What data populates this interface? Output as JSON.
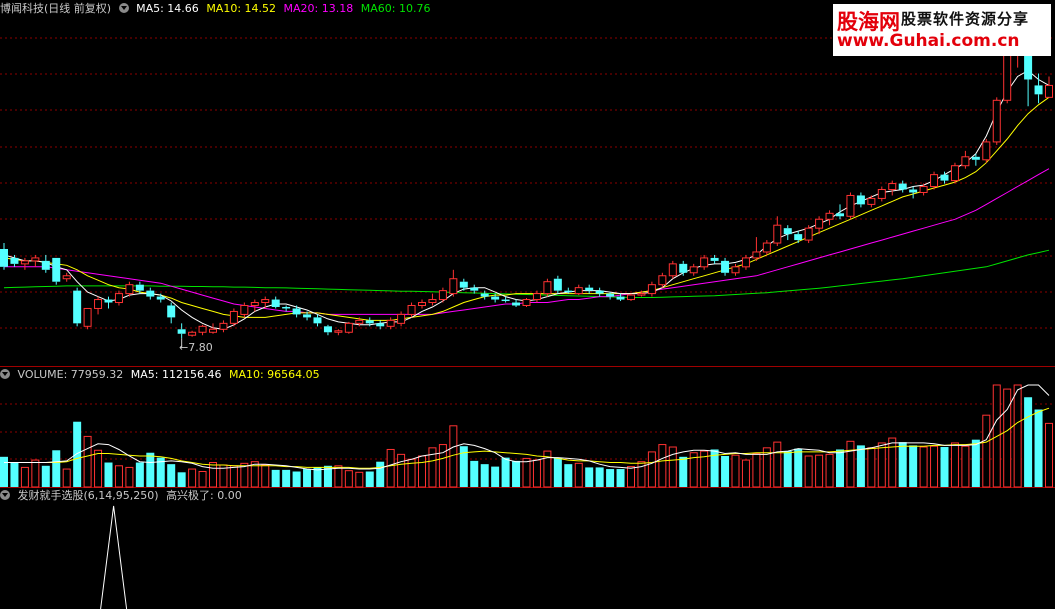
{
  "main_header": {
    "title": "博闻科技(日线 前复权)",
    "ma5": "MA5: 14.66",
    "ma10": "MA10: 14.52",
    "ma20": "MA20: 13.18",
    "ma60": "MA60: 10.76"
  },
  "volume_header": {
    "title": "VOLUME: 77959.32",
    "ma5": "MA5: 112156.46",
    "ma10": "MA10: 96564.05"
  },
  "indicator_header": {
    "title": "发财就手选股(6,14,95,250)",
    "value": "高兴极了: 0.00"
  },
  "watermark": {
    "brand": "股海网",
    "slogan": "股票软件资源分享",
    "url": "www.Guhai.com.cn"
  },
  "low_marker": "7.80",
  "colors": {
    "up": "#ff3232",
    "down": "#54ffff",
    "ma5": "#ffffff",
    "ma10": "#ffff00",
    "ma20": "#ff00ff",
    "ma60": "#00e400",
    "grid": "#8b0000",
    "divider": "#a00000",
    "header_text": "#c8c8c8"
  },
  "chart_data": {
    "type": "candlestick",
    "price_range": [
      7.0,
      18.5
    ],
    "candles": [
      {
        "o": 10.8,
        "c": 10.2,
        "h": 11.0,
        "l": 10.1
      },
      {
        "o": 10.5,
        "c": 10.3,
        "h": 10.6,
        "l": 10.2
      },
      {
        "o": 10.3,
        "c": 10.4,
        "h": 10.5,
        "l": 10.1
      },
      {
        "o": 10.4,
        "c": 10.5,
        "h": 10.6,
        "l": 10.2
      },
      {
        "o": 10.4,
        "c": 10.1,
        "h": 10.6,
        "l": 10.0
      },
      {
        "o": 10.5,
        "c": 9.7,
        "h": 10.5,
        "l": 9.6
      },
      {
        "o": 9.8,
        "c": 9.9,
        "h": 10.0,
        "l": 9.7
      },
      {
        "o": 9.4,
        "c": 8.3,
        "h": 9.5,
        "l": 8.2
      },
      {
        "o": 8.2,
        "c": 8.8,
        "h": 8.8,
        "l": 8.1
      },
      {
        "o": 8.8,
        "c": 9.1,
        "h": 9.2,
        "l": 8.6
      },
      {
        "o": 9.1,
        "c": 9.0,
        "h": 9.2,
        "l": 8.8
      },
      {
        "o": 9.0,
        "c": 9.3,
        "h": 9.4,
        "l": 8.9
      },
      {
        "o": 9.3,
        "c": 9.6,
        "h": 9.7,
        "l": 9.2
      },
      {
        "o": 9.6,
        "c": 9.4,
        "h": 9.7,
        "l": 9.3
      },
      {
        "o": 9.4,
        "c": 9.2,
        "h": 9.5,
        "l": 9.1
      },
      {
        "o": 9.2,
        "c": 9.1,
        "h": 9.3,
        "l": 9.0
      },
      {
        "o": 8.9,
        "c": 8.5,
        "h": 9.0,
        "l": 8.3
      },
      {
        "o": 8.1,
        "c": 7.95,
        "h": 8.3,
        "l": 7.8
      },
      {
        "o": 7.9,
        "c": 8.0,
        "h": 8.05,
        "l": 7.85
      },
      {
        "o": 8.0,
        "c": 8.2,
        "h": 8.25,
        "l": 7.9
      },
      {
        "o": 8.0,
        "c": 8.1,
        "h": 8.3,
        "l": 7.95
      },
      {
        "o": 8.1,
        "c": 8.3,
        "h": 8.4,
        "l": 8.0
      },
      {
        "o": 8.3,
        "c": 8.7,
        "h": 8.8,
        "l": 8.2
      },
      {
        "o": 8.6,
        "c": 8.9,
        "h": 9.0,
        "l": 8.5
      },
      {
        "o": 8.9,
        "c": 9.0,
        "h": 9.1,
        "l": 8.7
      },
      {
        "o": 9.0,
        "c": 9.1,
        "h": 9.2,
        "l": 8.8
      },
      {
        "o": 9.1,
        "c": 8.85,
        "h": 9.2,
        "l": 8.8
      },
      {
        "o": 8.85,
        "c": 8.8,
        "h": 8.9,
        "l": 8.7
      },
      {
        "o": 8.8,
        "c": 8.6,
        "h": 8.9,
        "l": 8.5
      },
      {
        "o": 8.6,
        "c": 8.5,
        "h": 8.7,
        "l": 8.4
      },
      {
        "o": 8.5,
        "c": 8.3,
        "h": 8.6,
        "l": 8.2
      },
      {
        "o": 8.2,
        "c": 8.0,
        "h": 8.25,
        "l": 7.9
      },
      {
        "o": 8.0,
        "c": 8.05,
        "h": 8.1,
        "l": 7.9
      },
      {
        "o": 8.0,
        "c": 8.3,
        "h": 8.35,
        "l": 7.95
      },
      {
        "o": 8.3,
        "c": 8.4,
        "h": 8.5,
        "l": 8.2
      },
      {
        "o": 8.4,
        "c": 8.3,
        "h": 8.5,
        "l": 8.2
      },
      {
        "o": 8.3,
        "c": 8.2,
        "h": 8.4,
        "l": 8.1
      },
      {
        "o": 8.2,
        "c": 8.4,
        "h": 8.5,
        "l": 8.1
      },
      {
        "o": 8.3,
        "c": 8.6,
        "h": 8.7,
        "l": 8.2
      },
      {
        "o": 8.6,
        "c": 8.9,
        "h": 9.0,
        "l": 8.5
      },
      {
        "o": 8.9,
        "c": 9.0,
        "h": 9.1,
        "l": 8.8
      },
      {
        "o": 9.0,
        "c": 9.1,
        "h": 9.3,
        "l": 8.9
      },
      {
        "o": 9.1,
        "c": 9.4,
        "h": 9.5,
        "l": 9.0
      },
      {
        "o": 9.3,
        "c": 9.8,
        "h": 10.1,
        "l": 9.2
      },
      {
        "o": 9.7,
        "c": 9.5,
        "h": 9.8,
        "l": 9.4
      },
      {
        "o": 9.5,
        "c": 9.4,
        "h": 9.6,
        "l": 9.3
      },
      {
        "o": 9.3,
        "c": 9.2,
        "h": 9.4,
        "l": 9.1
      },
      {
        "o": 9.2,
        "c": 9.1,
        "h": 9.3,
        "l": 9.0
      },
      {
        "o": 9.1,
        "c": 9.05,
        "h": 9.2,
        "l": 9.0
      },
      {
        "o": 9.0,
        "c": 8.9,
        "h": 9.1,
        "l": 8.85
      },
      {
        "o": 8.9,
        "c": 9.1,
        "h": 9.15,
        "l": 8.85
      },
      {
        "o": 9.1,
        "c": 9.3,
        "h": 9.4,
        "l": 9.0
      },
      {
        "o": 9.3,
        "c": 9.7,
        "h": 9.8,
        "l": 9.2
      },
      {
        "o": 9.8,
        "c": 9.4,
        "h": 9.9,
        "l": 9.3
      },
      {
        "o": 9.4,
        "c": 9.35,
        "h": 9.5,
        "l": 9.3
      },
      {
        "o": 9.3,
        "c": 9.5,
        "h": 9.6,
        "l": 9.25
      },
      {
        "o": 9.5,
        "c": 9.4,
        "h": 9.6,
        "l": 9.3
      },
      {
        "o": 9.4,
        "c": 9.3,
        "h": 9.5,
        "l": 9.2
      },
      {
        "o": 9.3,
        "c": 9.2,
        "h": 9.35,
        "l": 9.1
      },
      {
        "o": 9.2,
        "c": 9.1,
        "h": 9.3,
        "l": 9.05
      },
      {
        "o": 9.1,
        "c": 9.25,
        "h": 9.3,
        "l": 9.05
      },
      {
        "o": 9.25,
        "c": 9.3,
        "h": 9.4,
        "l": 9.2
      },
      {
        "o": 9.3,
        "c": 9.6,
        "h": 9.7,
        "l": 9.2
      },
      {
        "o": 9.6,
        "c": 9.9,
        "h": 10.0,
        "l": 9.5
      },
      {
        "o": 9.9,
        "c": 10.3,
        "h": 10.4,
        "l": 9.8
      },
      {
        "o": 10.3,
        "c": 10.0,
        "h": 10.4,
        "l": 9.9
      },
      {
        "o": 10.0,
        "c": 10.2,
        "h": 10.3,
        "l": 9.9
      },
      {
        "o": 10.2,
        "c": 10.5,
        "h": 10.6,
        "l": 10.1
      },
      {
        "o": 10.5,
        "c": 10.4,
        "h": 10.6,
        "l": 10.3
      },
      {
        "o": 10.4,
        "c": 10.0,
        "h": 10.5,
        "l": 9.9
      },
      {
        "o": 10.0,
        "c": 10.2,
        "h": 10.3,
        "l": 9.9
      },
      {
        "o": 10.2,
        "c": 10.5,
        "h": 10.6,
        "l": 10.1
      },
      {
        "o": 10.5,
        "c": 10.7,
        "h": 11.2,
        "l": 10.4
      },
      {
        "o": 10.7,
        "c": 11.0,
        "h": 11.1,
        "l": 10.6
      },
      {
        "o": 11.0,
        "c": 11.6,
        "h": 11.9,
        "l": 10.9
      },
      {
        "o": 11.5,
        "c": 11.3,
        "h": 11.6,
        "l": 11.1
      },
      {
        "o": 11.3,
        "c": 11.1,
        "h": 11.4,
        "l": 11.0
      },
      {
        "o": 11.1,
        "c": 11.5,
        "h": 11.6,
        "l": 11.0
      },
      {
        "o": 11.5,
        "c": 11.8,
        "h": 11.9,
        "l": 11.3
      },
      {
        "o": 11.8,
        "c": 12.0,
        "h": 12.1,
        "l": 11.6
      },
      {
        "o": 12.0,
        "c": 11.9,
        "h": 12.3,
        "l": 11.8
      },
      {
        "o": 11.9,
        "c": 12.6,
        "h": 12.7,
        "l": 11.8
      },
      {
        "o": 12.6,
        "c": 12.3,
        "h": 12.7,
        "l": 12.2
      },
      {
        "o": 12.3,
        "c": 12.5,
        "h": 12.6,
        "l": 12.2
      },
      {
        "o": 12.5,
        "c": 12.8,
        "h": 12.9,
        "l": 12.4
      },
      {
        "o": 12.8,
        "c": 13.0,
        "h": 13.1,
        "l": 12.6
      },
      {
        "o": 13.0,
        "c": 12.8,
        "h": 13.1,
        "l": 12.7
      },
      {
        "o": 12.8,
        "c": 12.7,
        "h": 12.9,
        "l": 12.5
      },
      {
        "o": 12.7,
        "c": 12.9,
        "h": 13.0,
        "l": 12.6
      },
      {
        "o": 12.9,
        "c": 13.3,
        "h": 13.4,
        "l": 12.8
      },
      {
        "o": 13.3,
        "c": 13.1,
        "h": 13.4,
        "l": 13.0
      },
      {
        "o": 13.1,
        "c": 13.6,
        "h": 13.7,
        "l": 13.0
      },
      {
        "o": 13.6,
        "c": 13.9,
        "h": 14.1,
        "l": 13.5
      },
      {
        "o": 13.9,
        "c": 13.8,
        "h": 14.0,
        "l": 13.6
      },
      {
        "o": 13.8,
        "c": 14.4,
        "h": 14.5,
        "l": 13.7
      },
      {
        "o": 14.4,
        "c": 15.8,
        "h": 15.9,
        "l": 14.3
      },
      {
        "o": 15.8,
        "c": 17.4,
        "h": 17.6,
        "l": 15.7
      },
      {
        "o": 17.4,
        "c": 17.5,
        "h": 17.9,
        "l": 16.9
      },
      {
        "o": 17.3,
        "c": 16.5,
        "h": 17.5,
        "l": 15.6
      },
      {
        "o": 16.3,
        "c": 16.0,
        "h": 16.7,
        "l": 15.7
      },
      {
        "o": 15.9,
        "c": 16.3,
        "h": 16.6,
        "l": 15.9
      },
      {
        "o": 16.5,
        "c": 16.0,
        "h": 16.6,
        "l": 15.7
      }
    ],
    "ma5": [
      10.6,
      10.5,
      10.4,
      10.4,
      10.35,
      10.2,
      10.1,
      9.7,
      9.35,
      9.2,
      9.05,
      9.1,
      9.25,
      9.3,
      9.3,
      9.25,
      9.05,
      8.75,
      8.5,
      8.3,
      8.15,
      8.1,
      8.25,
      8.45,
      8.7,
      8.85,
      8.95,
      8.95,
      8.85,
      8.75,
      8.6,
      8.45,
      8.35,
      8.3,
      8.25,
      8.25,
      8.3,
      8.35,
      8.35,
      8.5,
      8.7,
      8.85,
      9.05,
      9.3,
      9.45,
      9.5,
      9.5,
      9.35,
      9.2,
      9.1,
      9.05,
      9.1,
      9.2,
      9.3,
      9.35,
      9.4,
      9.4,
      9.4,
      9.35,
      9.3,
      9.3,
      9.3,
      9.35,
      9.5,
      9.8,
      10.0,
      10.15,
      10.25,
      10.3,
      10.3,
      10.35,
      10.45,
      10.6,
      10.9,
      11.15,
      11.3,
      11.4,
      11.5,
      11.65,
      11.8,
      12.05,
      12.25,
      12.4,
      12.55,
      12.7,
      12.75,
      12.8,
      12.9,
      12.95,
      13.1,
      13.3,
      13.5,
      13.7,
      14.0,
      14.6,
      15.4,
      16.1,
      16.6,
      16.8,
      16.5,
      16.3
    ],
    "ma10": [
      10.5,
      10.45,
      10.4,
      10.4,
      10.35,
      10.3,
      10.25,
      10.1,
      9.9,
      9.75,
      9.6,
      9.5,
      9.45,
      9.35,
      9.3,
      9.25,
      9.15,
      9.0,
      8.9,
      8.8,
      8.7,
      8.6,
      8.55,
      8.5,
      8.5,
      8.5,
      8.55,
      8.6,
      8.65,
      8.65,
      8.65,
      8.6,
      8.55,
      8.5,
      8.45,
      8.4,
      8.4,
      8.4,
      8.45,
      8.5,
      8.55,
      8.6,
      8.7,
      8.85,
      9.0,
      9.1,
      9.2,
      9.25,
      9.25,
      9.3,
      9.3,
      9.3,
      9.3,
      9.3,
      9.3,
      9.3,
      9.3,
      9.3,
      9.3,
      9.3,
      9.3,
      9.35,
      9.4,
      9.5,
      9.6,
      9.7,
      9.8,
      9.9,
      10.0,
      10.1,
      10.2,
      10.3,
      10.45,
      10.6,
      10.75,
      10.9,
      11.05,
      11.2,
      11.35,
      11.5,
      11.65,
      11.8,
      11.95,
      12.1,
      12.25,
      12.4,
      12.55,
      12.65,
      12.75,
      12.85,
      12.95,
      13.05,
      13.2,
      13.4,
      13.7,
      14.1,
      14.5,
      14.95,
      15.35,
      15.65,
      15.9
    ],
    "ma20": [
      10.2,
      10.2,
      10.2,
      10.2,
      10.2,
      10.15,
      10.1,
      10.05,
      10.0,
      9.95,
      9.9,
      9.85,
      9.8,
      9.75,
      9.7,
      9.65,
      9.55,
      9.45,
      9.35,
      9.25,
      9.15,
      9.05,
      8.95,
      8.9,
      8.85,
      8.8,
      8.75,
      8.7,
      8.7,
      8.65,
      8.65,
      8.6,
      8.6,
      8.6,
      8.6,
      8.6,
      8.6,
      8.6,
      8.6,
      8.6,
      8.6,
      8.6,
      8.65,
      8.7,
      8.75,
      8.8,
      8.85,
      8.9,
      8.95,
      8.95,
      9.0,
      9.0,
      9.0,
      9.05,
      9.1,
      9.1,
      9.15,
      9.2,
      9.2,
      9.25,
      9.3,
      9.35,
      9.4,
      9.45,
      9.5,
      9.55,
      9.6,
      9.65,
      9.7,
      9.75,
      9.8,
      9.85,
      9.9,
      10.0,
      10.1,
      10.2,
      10.3,
      10.4,
      10.5,
      10.6,
      10.7,
      10.8,
      10.9,
      11.0,
      11.1,
      11.2,
      11.3,
      11.4,
      11.5,
      11.6,
      11.7,
      11.8,
      11.95,
      12.1,
      12.3,
      12.5,
      12.7,
      12.9,
      13.1,
      13.3,
      13.5
    ],
    "ma60": [
      9.5,
      9.51,
      9.52,
      9.53,
      9.54,
      9.55,
      9.56,
      9.56,
      9.56,
      9.56,
      9.56,
      9.56,
      9.56,
      9.56,
      9.56,
      9.55,
      9.55,
      9.55,
      9.54,
      9.54,
      9.53,
      9.53,
      9.52,
      9.52,
      9.51,
      9.5,
      9.5,
      9.49,
      9.48,
      9.47,
      9.46,
      9.45,
      9.44,
      9.43,
      9.42,
      9.41,
      9.4,
      9.39,
      9.38,
      9.38,
      9.37,
      9.36,
      9.35,
      9.34,
      9.33,
      9.32,
      9.31,
      9.3,
      9.29,
      9.28,
      9.27,
      9.26,
      9.25,
      9.24,
      9.23,
      9.22,
      9.21,
      9.2,
      9.19,
      9.18,
      9.17,
      9.17,
      9.17,
      9.18,
      9.19,
      9.2,
      9.21,
      9.22,
      9.23,
      9.25,
      9.27,
      9.29,
      9.31,
      9.33,
      9.36,
      9.39,
      9.42,
      9.45,
      9.48,
      9.52,
      9.56,
      9.6,
      9.64,
      9.68,
      9.72,
      9.76,
      9.8,
      9.85,
      9.9,
      9.95,
      10.0,
      10.05,
      10.1,
      10.15,
      10.2,
      10.3,
      10.4,
      10.5,
      10.6,
      10.68,
      10.76
    ],
    "volume_range": [
      0,
      125000
    ],
    "volume": [
      37000,
      30000,
      24000,
      33000,
      26000,
      45000,
      22000,
      80000,
      62000,
      45000,
      30000,
      26000,
      24000,
      30000,
      42000,
      36000,
      28000,
      18000,
      22000,
      19000,
      30000,
      27000,
      26000,
      29000,
      31000,
      27000,
      21000,
      21000,
      19000,
      22000,
      24000,
      26000,
      26000,
      20000,
      18000,
      19000,
      31000,
      46000,
      40000,
      34000,
      38000,
      48000,
      52000,
      75000,
      50000,
      32000,
      28000,
      25000,
      36000,
      32000,
      35000,
      33000,
      44000,
      36000,
      28000,
      29000,
      24000,
      24000,
      22000,
      22000,
      25000,
      31000,
      43000,
      52000,
      49000,
      37000,
      42000,
      44000,
      46000,
      38000,
      39000,
      33000,
      41000,
      48000,
      55000,
      44000,
      47000,
      38000,
      39000,
      40000,
      46000,
      56000,
      51000,
      48000,
      54000,
      60000,
      55000,
      51000,
      49000,
      50000,
      49000,
      54000,
      50000,
      58000,
      88000,
      160000,
      120000,
      170000,
      110000,
      95000,
      77959
    ],
    "vol_ma5": [
      30000,
      30000,
      30000,
      30000,
      30000,
      31000,
      32000,
      41000,
      47000,
      53000,
      52000,
      46000,
      38000,
      31000,
      30000,
      31000,
      32000,
      31000,
      29000,
      25000,
      23000,
      23000,
      24000,
      25000,
      28000,
      28000,
      27000,
      26000,
      24000,
      22000,
      21000,
      22000,
      23000,
      23000,
      22000,
      22000,
      23000,
      27000,
      31000,
      34000,
      38000,
      40000,
      42000,
      49000,
      53000,
      51000,
      47000,
      42000,
      34000,
      31000,
      31000,
      33000,
      36000,
      36000,
      35000,
      34000,
      32000,
      28000,
      25000,
      24000,
      23000,
      25000,
      29000,
      35000,
      40000,
      43000,
      45000,
      45000,
      44000,
      41000,
      42000,
      40000,
      40000,
      40000,
      43000,
      44000,
      47000,
      46000,
      45000,
      42000,
      42000,
      44000,
      46000,
      48000,
      51000,
      54000,
      54000,
      54000,
      54000,
      53000,
      51000,
      51000,
      51000,
      52000,
      58000,
      82000,
      95000,
      119000,
      130000,
      131000,
      112156
    ],
    "vol_ma10": [
      30000,
      30000,
      30000,
      30000,
      30000,
      30000,
      31000,
      35000,
      38000,
      41000,
      41000,
      40000,
      39000,
      38000,
      38000,
      37000,
      35000,
      32000,
      30000,
      28000,
      27000,
      27000,
      26000,
      26000,
      26000,
      26000,
      26000,
      25000,
      25000,
      24000,
      24000,
      24000,
      24000,
      24000,
      23000,
      23000,
      24000,
      26000,
      28000,
      29000,
      30000,
      32000,
      35000,
      39000,
      42000,
      43000,
      44000,
      43000,
      42000,
      41000,
      40000,
      38000,
      37000,
      35000,
      33000,
      32000,
      32000,
      31000,
      30000,
      30000,
      29000,
      29000,
      30000,
      32000,
      33000,
      34000,
      36000,
      37000,
      39000,
      40000,
      41000,
      41000,
      42000,
      42000,
      42000,
      42000,
      43000,
      43000,
      43000,
      43000,
      44000,
      45000,
      46000,
      47000,
      48000,
      49000,
      50000,
      50000,
      50000,
      51000,
      51000,
      52000,
      52000,
      53000,
      55000,
      62000,
      69000,
      79000,
      86000,
      92000,
      96564
    ],
    "indicator_spike_index": 8,
    "annotations": [
      {
        "label": "7.80",
        "candle_index": 17
      }
    ]
  }
}
